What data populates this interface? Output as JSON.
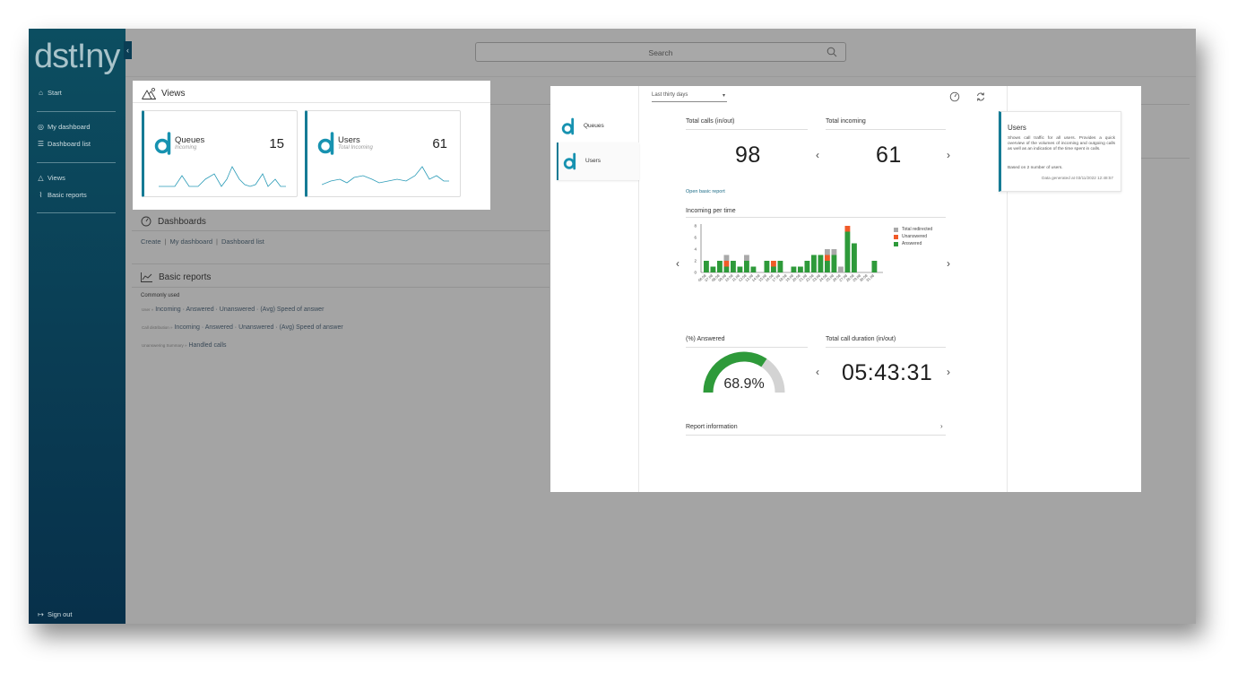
{
  "brand": {
    "logo_text_a": "dst",
    "logo_text_dot": "!",
    "logo_text_b": "ny"
  },
  "sidebar": {
    "items": [
      {
        "label": "Start",
        "icon": "home-icon"
      },
      {
        "label": "My dashboard",
        "icon": "gauge-icon"
      },
      {
        "label": "Dashboard list",
        "icon": "list-icon"
      },
      {
        "label": "Views",
        "icon": "views-icon"
      },
      {
        "label": "Basic reports",
        "icon": "chart-icon"
      }
    ],
    "signout": "Sign out"
  },
  "search": {
    "placeholder": "Search"
  },
  "views": {
    "title": "Views",
    "cards": [
      {
        "name": "Queues",
        "sub": "Incoming",
        "value": "15"
      },
      {
        "name": "Users",
        "sub": "Total Incoming",
        "value": "61"
      }
    ]
  },
  "dashboards": {
    "title": "Dashboards",
    "links": [
      "Create",
      "My dashboard",
      "Dashboard list"
    ]
  },
  "basic_reports": {
    "title": "Basic reports",
    "commonly_used": "Commonly used",
    "rows": [
      {
        "prefix": "User »",
        "items": "Incoming · Answered · Unanswered · (Avg) Speed of answer"
      },
      {
        "prefix": "Call distribution »",
        "items": "Incoming · Answered · Unanswered · (Avg) Speed of answer"
      },
      {
        "prefix": "Unanswering Summary »",
        "items": "Handled calls"
      }
    ]
  },
  "panel": {
    "nav": [
      {
        "label": "Queues"
      },
      {
        "label": "Users"
      }
    ],
    "period": "Last thirty days",
    "kpis": {
      "total_calls_label": "Total calls (in/out)",
      "total_calls_value": "98",
      "total_incoming_label": "Total incoming",
      "total_incoming_value": "61",
      "answered_label": "(%) Answered",
      "answered_value": "68.9%",
      "answered_fraction": 0.689,
      "duration_label": "Total call duration (in/out)",
      "duration_value": "05:43:31"
    },
    "open_report": "Open basic report",
    "chart_title": "Incoming per time",
    "report_info": "Report information",
    "info": {
      "title": "Users",
      "description": "Shows call traffic for all users. Provides a quick overview of the volumes of incoming and outgoing calls as well as an indication of the time spent in calls.",
      "based_on": "Based on 2 number of users.",
      "generated": "Data generated at 03/11/2022 12:48:57"
    }
  },
  "colors": {
    "accent": "#157b95",
    "answered": "#2e9a3a",
    "unanswered": "#f05a28",
    "redirected": "#a9a9a9"
  },
  "chart_data": {
    "type": "bar",
    "title": "Incoming per time",
    "stacked": true,
    "categories": [
      "06.08",
      "07.08",
      "08.08",
      "09.08",
      "10.08",
      "11.08",
      "12.08",
      "13.08",
      "14.08",
      "15.08",
      "16.08",
      "17.08",
      "18.08",
      "19.08",
      "20.08",
      "21.08",
      "22.08",
      "23.08",
      "24.08",
      "25.08",
      "26.08",
      "27.08",
      "28.08",
      "29.08",
      "30.08",
      "31.08"
    ],
    "ylim": [
      0,
      8
    ],
    "yticks": [
      0,
      2,
      4,
      6,
      8
    ],
    "legend_position": "right",
    "series": [
      {
        "name": "Answered",
        "color": "#2e9a3a",
        "values": [
          2,
          1,
          2,
          1,
          2,
          1,
          2,
          1,
          0,
          2,
          1,
          2,
          0,
          1,
          1,
          2,
          3,
          3,
          2,
          3,
          0,
          7,
          5,
          0,
          0,
          2
        ]
      },
      {
        "name": "Unanswered",
        "color": "#f05a28",
        "values": [
          0,
          0,
          0,
          1,
          0,
          0,
          0,
          0,
          0,
          0,
          1,
          0,
          0,
          0,
          0,
          0,
          0,
          0,
          1,
          0,
          0,
          1,
          0,
          0,
          0,
          0
        ]
      },
      {
        "name": "Total redirected",
        "color": "#a9a9a9",
        "values": [
          0,
          0,
          0,
          1,
          0,
          0,
          1,
          0,
          0,
          0,
          0,
          0,
          0,
          0,
          0,
          0,
          0,
          0,
          1,
          1,
          1,
          0,
          0,
          0,
          0,
          0
        ]
      }
    ]
  }
}
